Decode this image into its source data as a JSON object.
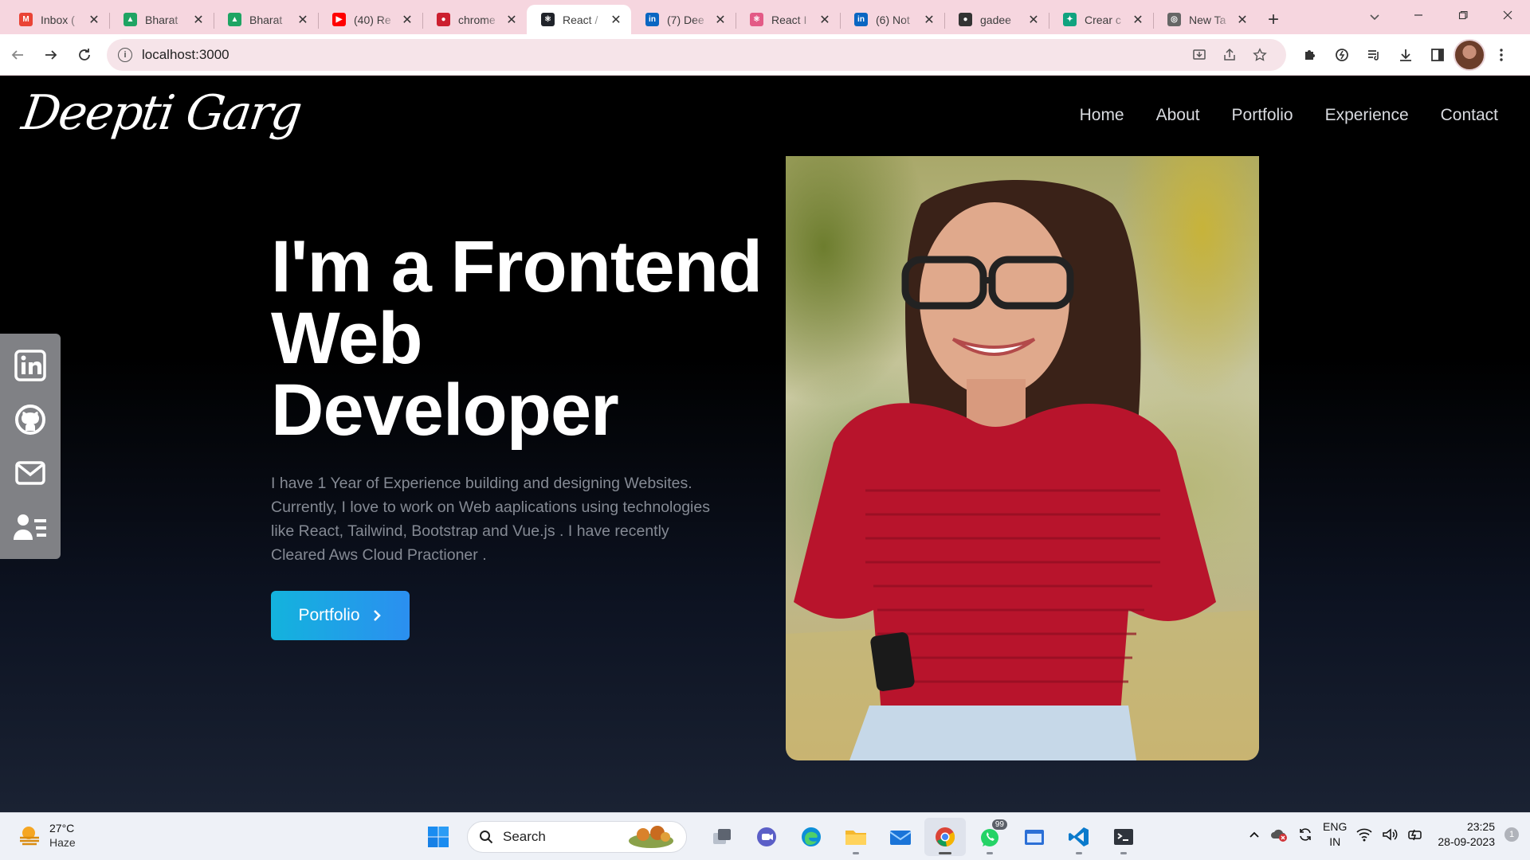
{
  "browser": {
    "tabs": [
      {
        "title": "Inbox (",
        "icon": "gmail-icon",
        "color": "#ea4335",
        "glyph": "M"
      },
      {
        "title": "Bharat",
        "icon": "google-drive-icon",
        "color": "#1fa463",
        "glyph": "▲"
      },
      {
        "title": "Bharat",
        "icon": "google-drive-icon",
        "color": "#1fa463",
        "glyph": "▲"
      },
      {
        "title": "(40) Re",
        "icon": "youtube-icon",
        "color": "#ff0000",
        "glyph": "▶"
      },
      {
        "title": "chrome",
        "icon": "chrome-record-icon",
        "color": "#cc1f2f",
        "glyph": "●"
      },
      {
        "title": "React /",
        "icon": "react-icon",
        "color": "#20232a",
        "glyph": "⚛"
      },
      {
        "title": "(7) Dee",
        "icon": "linkedin-icon",
        "color": "#0a66c2",
        "glyph": "in"
      },
      {
        "title": "React I",
        "icon": "react-icon",
        "color": "#e35a86",
        "glyph": "⚛"
      },
      {
        "title": "(6) Not",
        "icon": "linkedin-icon",
        "color": "#0a66c2",
        "glyph": "in"
      },
      {
        "title": "gadee",
        "icon": "github-icon",
        "color": "#333333",
        "glyph": "●"
      },
      {
        "title": "Crear c",
        "icon": "chatgpt-icon",
        "color": "#10a37f",
        "glyph": "✦"
      },
      {
        "title": "New Ta",
        "icon": "chrome-icon",
        "color": "#666666",
        "glyph": "◎"
      }
    ],
    "active_tab_index": 5,
    "url": "localhost:3000"
  },
  "site": {
    "logo": "Deepti Garg",
    "nav": [
      "Home",
      "About",
      "Portfolio",
      "Experience",
      "Contact"
    ],
    "hero_line1": "I'm a Frontend",
    "hero_line2": "Web",
    "hero_line3": "Developer",
    "description": "I have 1 Year of Experience building and designing Websites. Currently, I love to work on Web aaplications using technologies like React, Tailwind, Bootstrap and Vue.js . I have recently Cleared Aws Cloud Practioner .",
    "cta_label": "Portfolio",
    "social": [
      "linkedin-icon",
      "github-icon",
      "mail-icon",
      "resume-icon"
    ],
    "accent": "#13b3dd"
  },
  "taskbar": {
    "temperature": "27°C",
    "weather": "Haze",
    "search_label": "Search",
    "whatsapp_badge": "99",
    "lang_line1": "ENG",
    "lang_line2": "IN",
    "time": "23:25",
    "date": "28-09-2023",
    "notifications": "1"
  }
}
